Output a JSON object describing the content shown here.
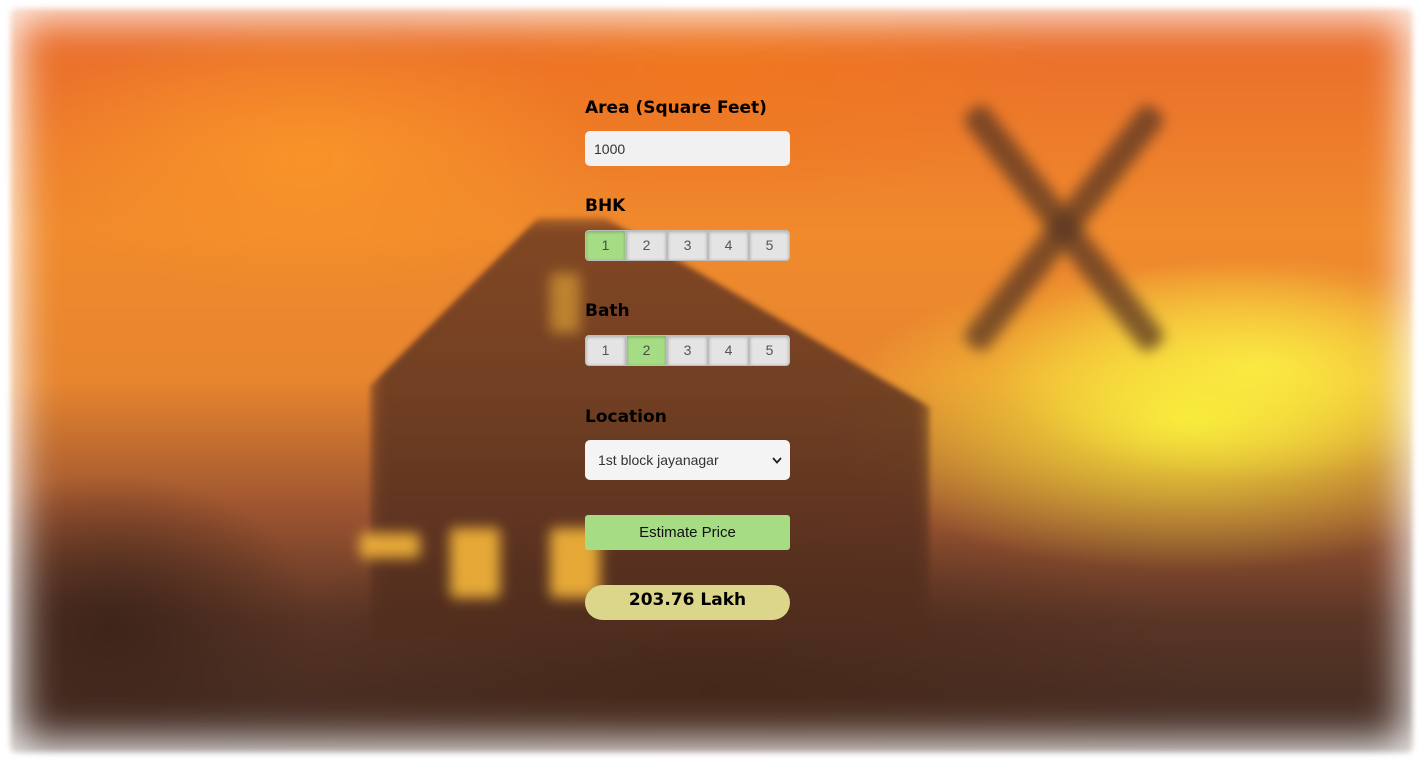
{
  "form": {
    "area": {
      "label": "Area (Square Feet)",
      "value": "1000"
    },
    "bhk": {
      "label": "BHK",
      "options": [
        "1",
        "2",
        "3",
        "4",
        "5"
      ],
      "selected": "1"
    },
    "bath": {
      "label": "Bath",
      "options": [
        "1",
        "2",
        "3",
        "4",
        "5"
      ],
      "selected": "2"
    },
    "location": {
      "label": "Location",
      "selected": "1st block jayanagar"
    },
    "estimate_button": "Estimate Price",
    "result": "203.76 Lakh"
  },
  "colors": {
    "active_option": "#a6dd84",
    "button": "#a6dd84",
    "result_background": "#dcd68a",
    "input_background": "#f1f1f1"
  },
  "icons": {
    "location_dropdown": "chevron-down-icon"
  }
}
